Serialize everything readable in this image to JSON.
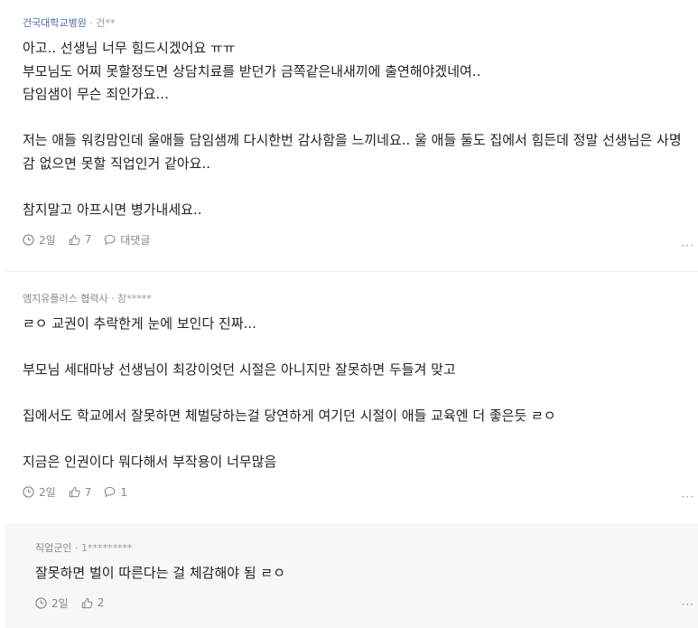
{
  "comments": [
    {
      "author": "건국대학교병원",
      "nickname": "건**",
      "text": "아고.. 선생님 너무 힘드시겠어요 ㅠㅠ\n부모님도 어찌 못할정도면 상담치료를 받던가 금쪽같은내새끼에 출연해야겠네여..\n담임샘이 무슨 죄인가요...\n\n저는 애들 워킹맘인데 울애들 담임샘께 다시한번 감사함을 느끼네요.. 울 애들 둘도 집에서 힘든데 정말 선생님은 사명감 없으면 못할 직업인거 같아요..\n\n참지말고 아프시면 병가내세요..",
      "time": "2일",
      "likes": "7",
      "reply_label": "대댓글",
      "more": "···"
    },
    {
      "author": "엠지유플러스 협력사",
      "nickname": "참*****",
      "text": "ㄹㅇ 교권이 추락한게 눈에 보인다 진짜...\n\n부모님 세대마냥 선생님이 최강이엇던 시절은 아니지만 잘못하면 두들겨 맞고\n\n집에서도 학교에서 잘못하면 체벌당하는걸 당연하게 여기던 시절이 애들 교육엔 더 좋은듯 ㄹㅇ\n\n지금은 인권이다 뭐다해서 부작용이 너무많음",
      "time": "2일",
      "likes": "7",
      "replies": "1",
      "more": "···"
    },
    {
      "author": "직업군인",
      "nickname": "1*********",
      "text": "잘못하면 벌이 따른다는 걸 체감해야 됨 ㄹㅇ",
      "time": "2일",
      "likes": "2",
      "more": "···"
    }
  ],
  "separator": "·",
  "icons": {
    "time": "clock-icon",
    "like": "thumbs-up-icon",
    "reply": "speech-bubble-icon",
    "more": "more-icon"
  },
  "colors": {
    "author_blue": "#4a6fa5",
    "meta_gray": "#888888",
    "reply_bg": "#f7f7f8"
  }
}
